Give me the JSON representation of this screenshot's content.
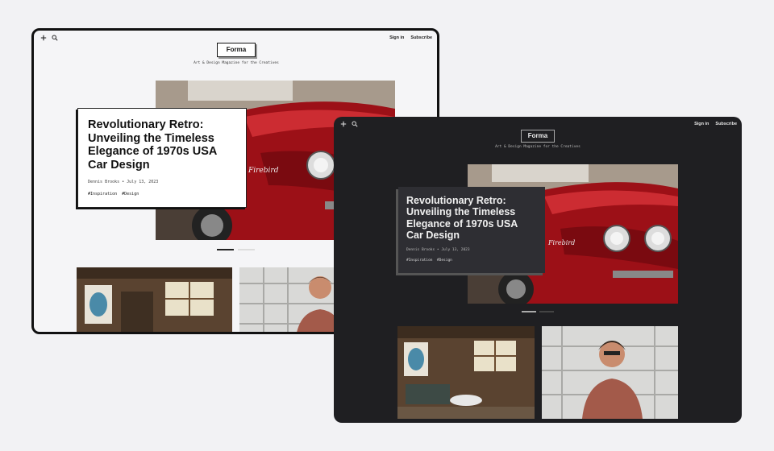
{
  "light": {
    "header": {
      "sign_in": "Sign in",
      "subscribe": "Subscribe",
      "logo": "Forma",
      "tagline": "Art & Design Magazine for the Creatives"
    },
    "hero": {
      "title": "Revolutionary Retro: Unveiling the Timeless Elegance of 1970s USA Car Design",
      "meta": "Dennis Brooks • July 13, 2023",
      "tags": "#Inspiration  #Design"
    }
  },
  "dark": {
    "header": {
      "sign_in": "Sign in",
      "subscribe": "Subscribe",
      "logo": "Forma",
      "tagline": "Art & Design Magazine for the Creatives"
    },
    "hero": {
      "title": "Revolutionary Retro: Unveiling the Timeless Elegance of 1970s USA Car Design",
      "meta": "Dennis Brooks • July 13, 2023",
      "tags": "#Inspiration  #Design"
    }
  },
  "car_badge": "Firebird",
  "icons": [
    "plus-icon",
    "search-icon"
  ],
  "colors": {
    "light_bg": "#f5f5f7",
    "dark_bg": "#1f1f22",
    "car_red": "#a3111a",
    "card_dark": "#2e2e33"
  }
}
